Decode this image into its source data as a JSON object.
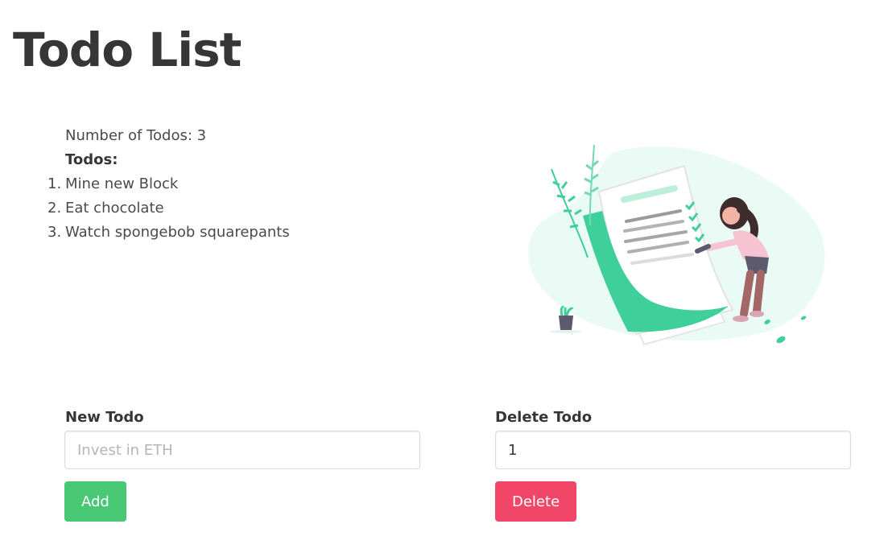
{
  "page": {
    "title": "Todo List"
  },
  "summary": {
    "count_text": "Number of Todos: 3",
    "todos_heading": "Todos:",
    "items": [
      {
        "number": "1.",
        "text": "Mine new Block"
      },
      {
        "number": "2.",
        "text": "Eat chocolate"
      },
      {
        "number": "3.",
        "text": "Watch spongebob squarepants"
      }
    ]
  },
  "new_todo": {
    "label": "New Todo",
    "placeholder": "Invest in ETH",
    "value": "",
    "button_label": "Add",
    "button_color": "#48c774"
  },
  "delete_todo": {
    "label": "Delete Todo",
    "value": "1",
    "button_label": "Delete",
    "button_color": "#f14668"
  },
  "illustration": {
    "name": "checklist-illustration",
    "accent": "#3ecf9a",
    "blob": "#eafaf4"
  }
}
